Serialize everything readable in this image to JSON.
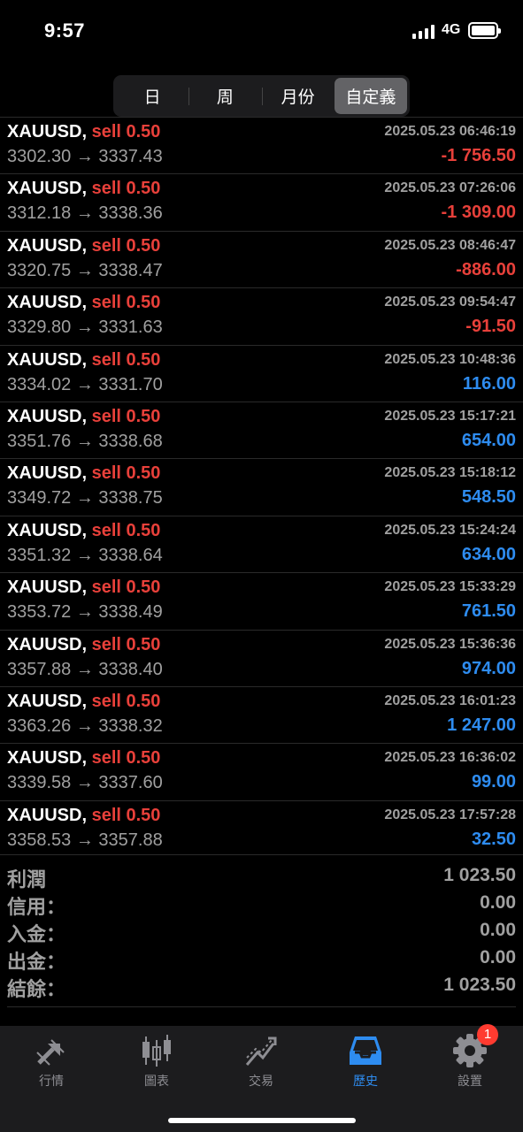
{
  "status": {
    "time": "9:57",
    "network": "4G"
  },
  "segments": [
    {
      "label": "日",
      "active": false
    },
    {
      "label": "周",
      "active": false
    },
    {
      "label": "月份",
      "active": false
    },
    {
      "label": "自定義",
      "active": true
    }
  ],
  "trades": [
    {
      "symbol": "XAUUSD,",
      "side": "sell 0.50",
      "time": "2025.05.23 06:46:19",
      "open": "3302.30",
      "close": "3337.43",
      "profit": "-1 756.50",
      "sign": "neg"
    },
    {
      "symbol": "XAUUSD,",
      "side": "sell 0.50",
      "time": "2025.05.23 07:26:06",
      "open": "3312.18",
      "close": "3338.36",
      "profit": "-1 309.00",
      "sign": "neg"
    },
    {
      "symbol": "XAUUSD,",
      "side": "sell 0.50",
      "time": "2025.05.23 08:46:47",
      "open": "3320.75",
      "close": "3338.47",
      "profit": "-886.00",
      "sign": "neg"
    },
    {
      "symbol": "XAUUSD,",
      "side": "sell 0.50",
      "time": "2025.05.23 09:54:47",
      "open": "3329.80",
      "close": "3331.63",
      "profit": "-91.50",
      "sign": "neg"
    },
    {
      "symbol": "XAUUSD,",
      "side": "sell 0.50",
      "time": "2025.05.23 10:48:36",
      "open": "3334.02",
      "close": "3331.70",
      "profit": "116.00",
      "sign": "pos"
    },
    {
      "symbol": "XAUUSD,",
      "side": "sell 0.50",
      "time": "2025.05.23 15:17:21",
      "open": "3351.76",
      "close": "3338.68",
      "profit": "654.00",
      "sign": "pos"
    },
    {
      "symbol": "XAUUSD,",
      "side": "sell 0.50",
      "time": "2025.05.23 15:18:12",
      "open": "3349.72",
      "close": "3338.75",
      "profit": "548.50",
      "sign": "pos"
    },
    {
      "symbol": "XAUUSD,",
      "side": "sell 0.50",
      "time": "2025.05.23 15:24:24",
      "open": "3351.32",
      "close": "3338.64",
      "profit": "634.00",
      "sign": "pos"
    },
    {
      "symbol": "XAUUSD,",
      "side": "sell 0.50",
      "time": "2025.05.23 15:33:29",
      "open": "3353.72",
      "close": "3338.49",
      "profit": "761.50",
      "sign": "pos"
    },
    {
      "symbol": "XAUUSD,",
      "side": "sell 0.50",
      "time": "2025.05.23 15:36:36",
      "open": "3357.88",
      "close": "3338.40",
      "profit": "974.00",
      "sign": "pos"
    },
    {
      "symbol": "XAUUSD,",
      "side": "sell 0.50",
      "time": "2025.05.23 16:01:23",
      "open": "3363.26",
      "close": "3338.32",
      "profit": "1 247.00",
      "sign": "pos"
    },
    {
      "symbol": "XAUUSD,",
      "side": "sell 0.50",
      "time": "2025.05.23 16:36:02",
      "open": "3339.58",
      "close": "3337.60",
      "profit": "99.00",
      "sign": "pos"
    },
    {
      "symbol": "XAUUSD,",
      "side": "sell 0.50",
      "time": "2025.05.23 17:57:28",
      "open": "3358.53",
      "close": "3357.88",
      "profit": "32.50",
      "sign": "pos"
    }
  ],
  "arrow": "→",
  "summary": [
    {
      "label": "利潤",
      "value": "1 023.50"
    },
    {
      "label": "信用：",
      "value": "0.00"
    },
    {
      "label": "入金：",
      "value": "0.00"
    },
    {
      "label": "出金：",
      "value": "0.00"
    },
    {
      "label": "結餘：",
      "value": "1 023.50"
    }
  ],
  "tabbar": [
    {
      "label": "行情",
      "icon": "quotes-arrows-icon",
      "active": false
    },
    {
      "label": "圖表",
      "icon": "candlestick-chart-icon",
      "active": false
    },
    {
      "label": "交易",
      "icon": "trade-line-icon",
      "active": false
    },
    {
      "label": "歷史",
      "icon": "history-tray-icon",
      "active": true
    },
    {
      "label": "設置",
      "icon": "gear-icon",
      "active": false,
      "badge": "1"
    }
  ],
  "colors": {
    "negative": "#e8403a",
    "positive": "#2e8cf0",
    "accent": "#2e8cf0"
  }
}
